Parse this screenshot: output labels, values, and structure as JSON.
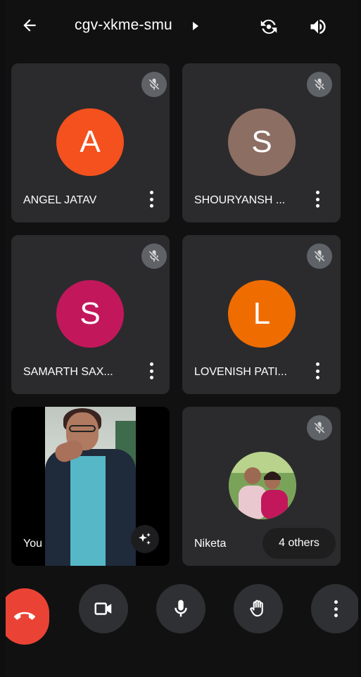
{
  "header": {
    "meeting_code": "cgv-xkme-smu"
  },
  "participants": [
    {
      "name": "ANGEL JATAV",
      "initial": "A",
      "color": "#f4511e",
      "muted": true
    },
    {
      "name": "SHOURYANSH ...",
      "initial": "S",
      "color": "#8d6e63",
      "muted": true
    },
    {
      "name": "SAMARTH SAX...",
      "initial": "S",
      "color": "#c2185b",
      "muted": true
    },
    {
      "name": "LOVENISH PATI...",
      "initial": "L",
      "color": "#ef6c00",
      "muted": true
    }
  ],
  "self_tile": {
    "label": "You"
  },
  "group_tile": {
    "name": "Niketa",
    "others_label": "4 others",
    "muted": true
  },
  "icons": {
    "back": "arrow-left-icon",
    "caret": "caret-right-icon",
    "flip_camera": "flip-camera-icon",
    "speaker": "speaker-icon",
    "mic_off": "mic-off-icon",
    "more": "more-vert-icon",
    "effects": "sparkles-icon",
    "hang_up": "call-end-icon",
    "camera": "videocam-icon",
    "mic": "mic-icon",
    "raise_hand": "hand-icon"
  },
  "colors": {
    "background": "#111111",
    "tile": "#2b2b2d",
    "hangup": "#ea4335",
    "control": "#2f3033"
  }
}
